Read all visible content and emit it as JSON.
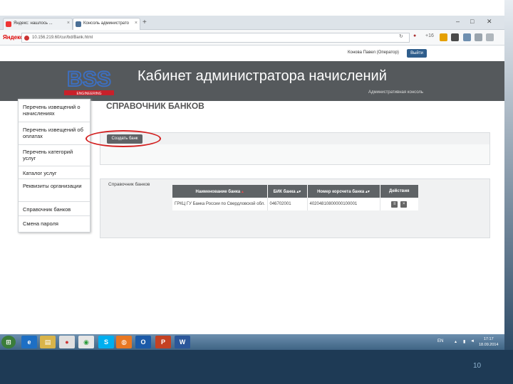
{
  "browser": {
    "tabs": [
      {
        "label": "Яндекс: нашлось ..."
      },
      {
        "label": "Консоль администрато"
      }
    ],
    "yandex_label": "Яндекс",
    "url": "10.156.219.60/cur/bd/Bank.html",
    "speed": "+16"
  },
  "userbar": {
    "user": "Конова Павел (Оператор)",
    "logout": "Выйти"
  },
  "banner": {
    "title": "Кабинет администратора начислений",
    "subtitle": "Административная консоль",
    "logo_text": "BSS",
    "logo_sub": "ENGINEERING"
  },
  "sidebar": {
    "items": [
      {
        "label": "Перечень извещений о начислениях"
      },
      {
        "label": "Перечень извещений об оплатах"
      },
      {
        "label": "Перечень категорий услуг"
      },
      {
        "label": "Каталог услуг"
      },
      {
        "label": "Реквизиты организации"
      },
      {
        "label": "Справочник банков"
      },
      {
        "label": "Смена пароля"
      }
    ]
  },
  "main": {
    "title": "СПРАВОЧНИК БАНКОВ",
    "actions_label": "Действия",
    "create_button": "Создать банк",
    "banks_label": "Справочник банков",
    "table": {
      "columns": [
        "Наименование банка",
        "БИК банка",
        "Номер корсчета банка",
        "Действия"
      ],
      "rows": [
        {
          "name": "ГРКЦ ГУ Банка России по Свердловской обл.",
          "bik": "046702001",
          "account": "40204810800000100001"
        }
      ]
    }
  },
  "taskbar": {
    "lang": "EN",
    "time": "17:17",
    "date": "18.09.2014"
  },
  "slide": {
    "number": "10"
  }
}
